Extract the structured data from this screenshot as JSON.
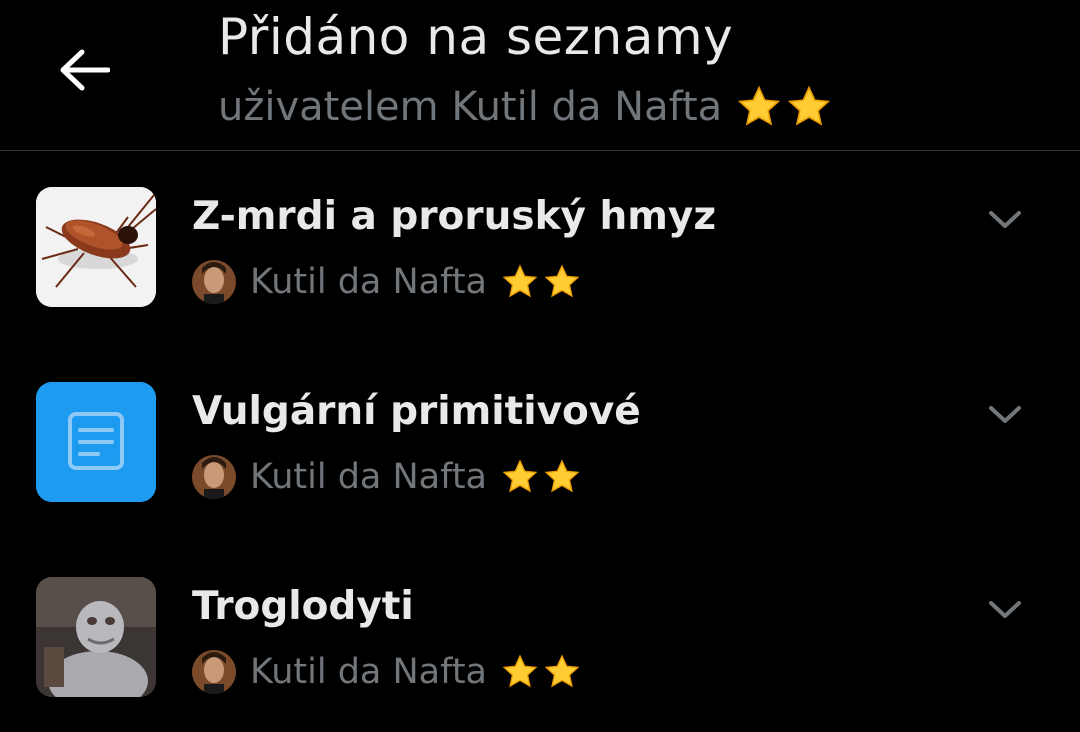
{
  "header": {
    "title": "Přidáno na seznamy",
    "subtitle": "uživatelem Kutil da Nafta",
    "back_icon": "arrow-left-icon"
  },
  "lists": [
    {
      "name": "Z-mrdi a proruský hmyz",
      "owner": "Kutil da Nafta",
      "thumbnail": "cockroach-image"
    },
    {
      "name": "Vulgární primitivové",
      "owner": "Kutil da Nafta",
      "thumbnail": "list-document-icon"
    },
    {
      "name": "Troglodyti",
      "owner": "Kutil da Nafta",
      "thumbnail": "troglodyte-image"
    }
  ],
  "colors": {
    "background": "#000000",
    "text_primary": "#e7e9ea",
    "text_secondary": "#71767b",
    "divider": "#2f3336",
    "accent_blue": "#1d9bf0",
    "star": "#ffcc33"
  }
}
